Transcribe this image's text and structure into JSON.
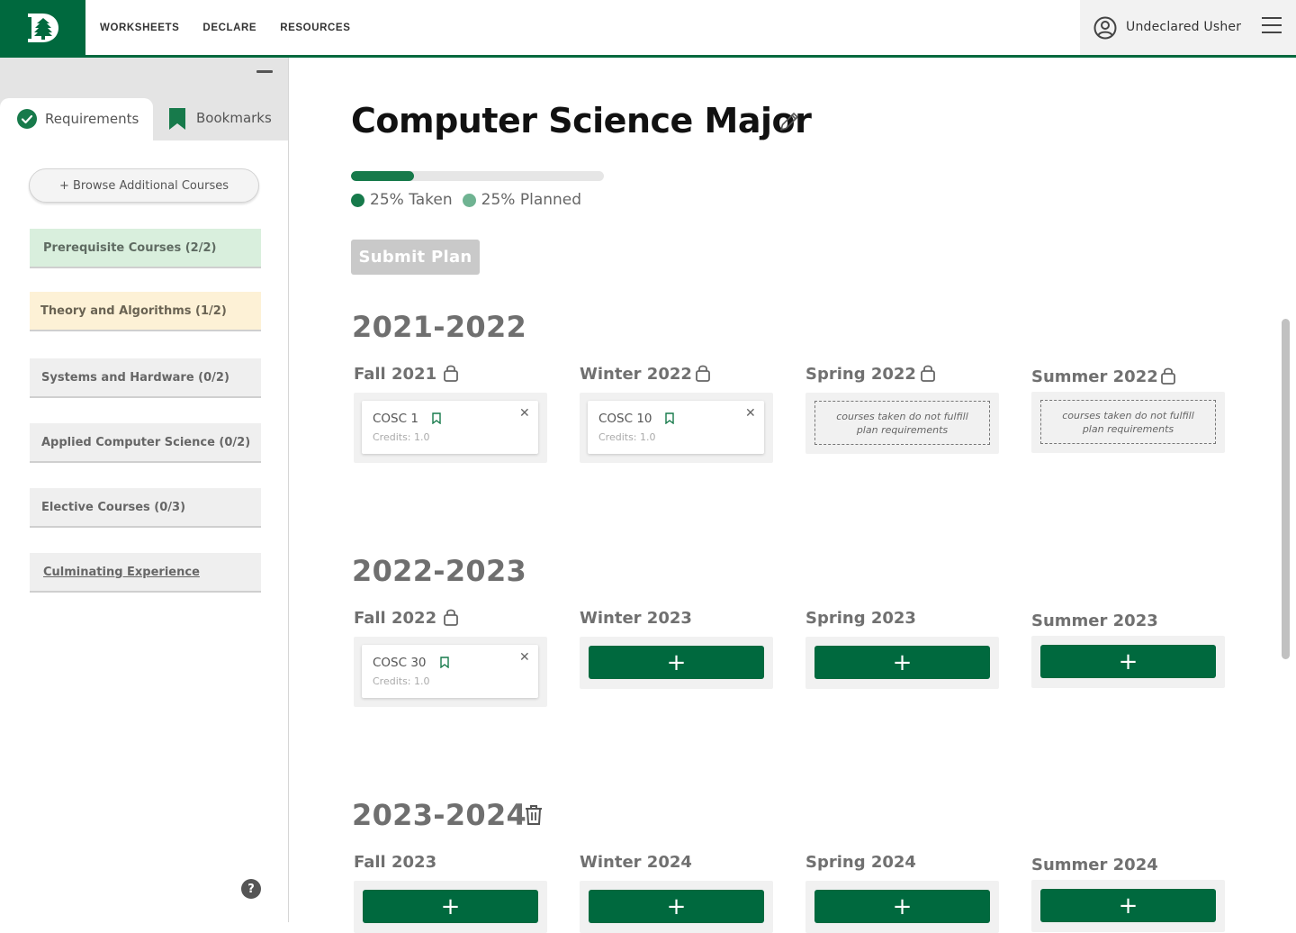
{
  "nav": {
    "links": [
      "WORKSHEETS",
      "DECLARE",
      "RESOURCES"
    ],
    "user_name": "Undeclared Usher"
  },
  "sidebar": {
    "tabs": [
      {
        "label": "Requirements",
        "icon": "check-circle-icon",
        "active": true
      },
      {
        "label": "Bookmarks",
        "icon": "bookmark-icon",
        "active": false
      }
    ],
    "browse_label": "+ Browse Additional Courses",
    "requirements": [
      {
        "label": "Prerequisite Courses (2/2)",
        "status": "complete"
      },
      {
        "label": "Theory and Algorithms (1/2)",
        "status": "partial"
      },
      {
        "label": "Systems and Hardware (0/2)",
        "status": "none"
      },
      {
        "label": "Applied Computer Science (0/2)",
        "status": "none"
      },
      {
        "label": "Elective Courses (0/3)",
        "status": "none"
      },
      {
        "label": "Culminating Experience",
        "status": "link"
      }
    ],
    "help_label": "?"
  },
  "main": {
    "title": "Computer Science Major",
    "progress": {
      "taken_pct": 25,
      "taken_label": "25% Taken",
      "planned_label": "25% Planned"
    },
    "submit_label": "Submit Plan",
    "empty_term_note": "courses taken do not fulfill plan requirements",
    "years": [
      {
        "label": "2021-2022",
        "terms": [
          {
            "label": "Fall 2021",
            "locked": true,
            "courses": [
              {
                "name": "COSC 1",
                "credits": "Credits: 1.0"
              }
            ]
          },
          {
            "label": "Winter 2022",
            "locked": true,
            "courses": [
              {
                "name": "COSC 10",
                "credits": "Credits: 1.0"
              }
            ]
          },
          {
            "label": "Spring 2022",
            "locked": true,
            "courses": []
          },
          {
            "label": "Summer 2022",
            "locked": true,
            "courses": []
          }
        ]
      },
      {
        "label": "2022-2023",
        "terms": [
          {
            "label": "Fall 2022",
            "locked": true,
            "courses": [
              {
                "name": "COSC 30",
                "credits": "Credits: 1.0"
              }
            ]
          },
          {
            "label": "Winter 2023",
            "locked": false,
            "add_label": "+"
          },
          {
            "label": "Spring 2023",
            "locked": false,
            "add_label": "+"
          },
          {
            "label": "Summer 2023",
            "locked": false,
            "add_label": "+"
          }
        ]
      },
      {
        "label": "2023-2024",
        "deletable": true,
        "terms": [
          {
            "label": "Fall 2023",
            "locked": false,
            "add_label": "+"
          },
          {
            "label": "Winter 2024",
            "locked": false,
            "add_label": "+"
          },
          {
            "label": "Spring 2024",
            "locked": false,
            "add_label": "+"
          },
          {
            "label": "Summer 2024",
            "locked": false,
            "add_label": "+"
          }
        ]
      }
    ]
  },
  "colors": {
    "brand_green": "#00693e",
    "progress_taken": "#177a4b",
    "progress_planned": "#6fb392",
    "req_complete_bg": "#d9efdd",
    "req_partial_bg": "#fdf1d6"
  }
}
